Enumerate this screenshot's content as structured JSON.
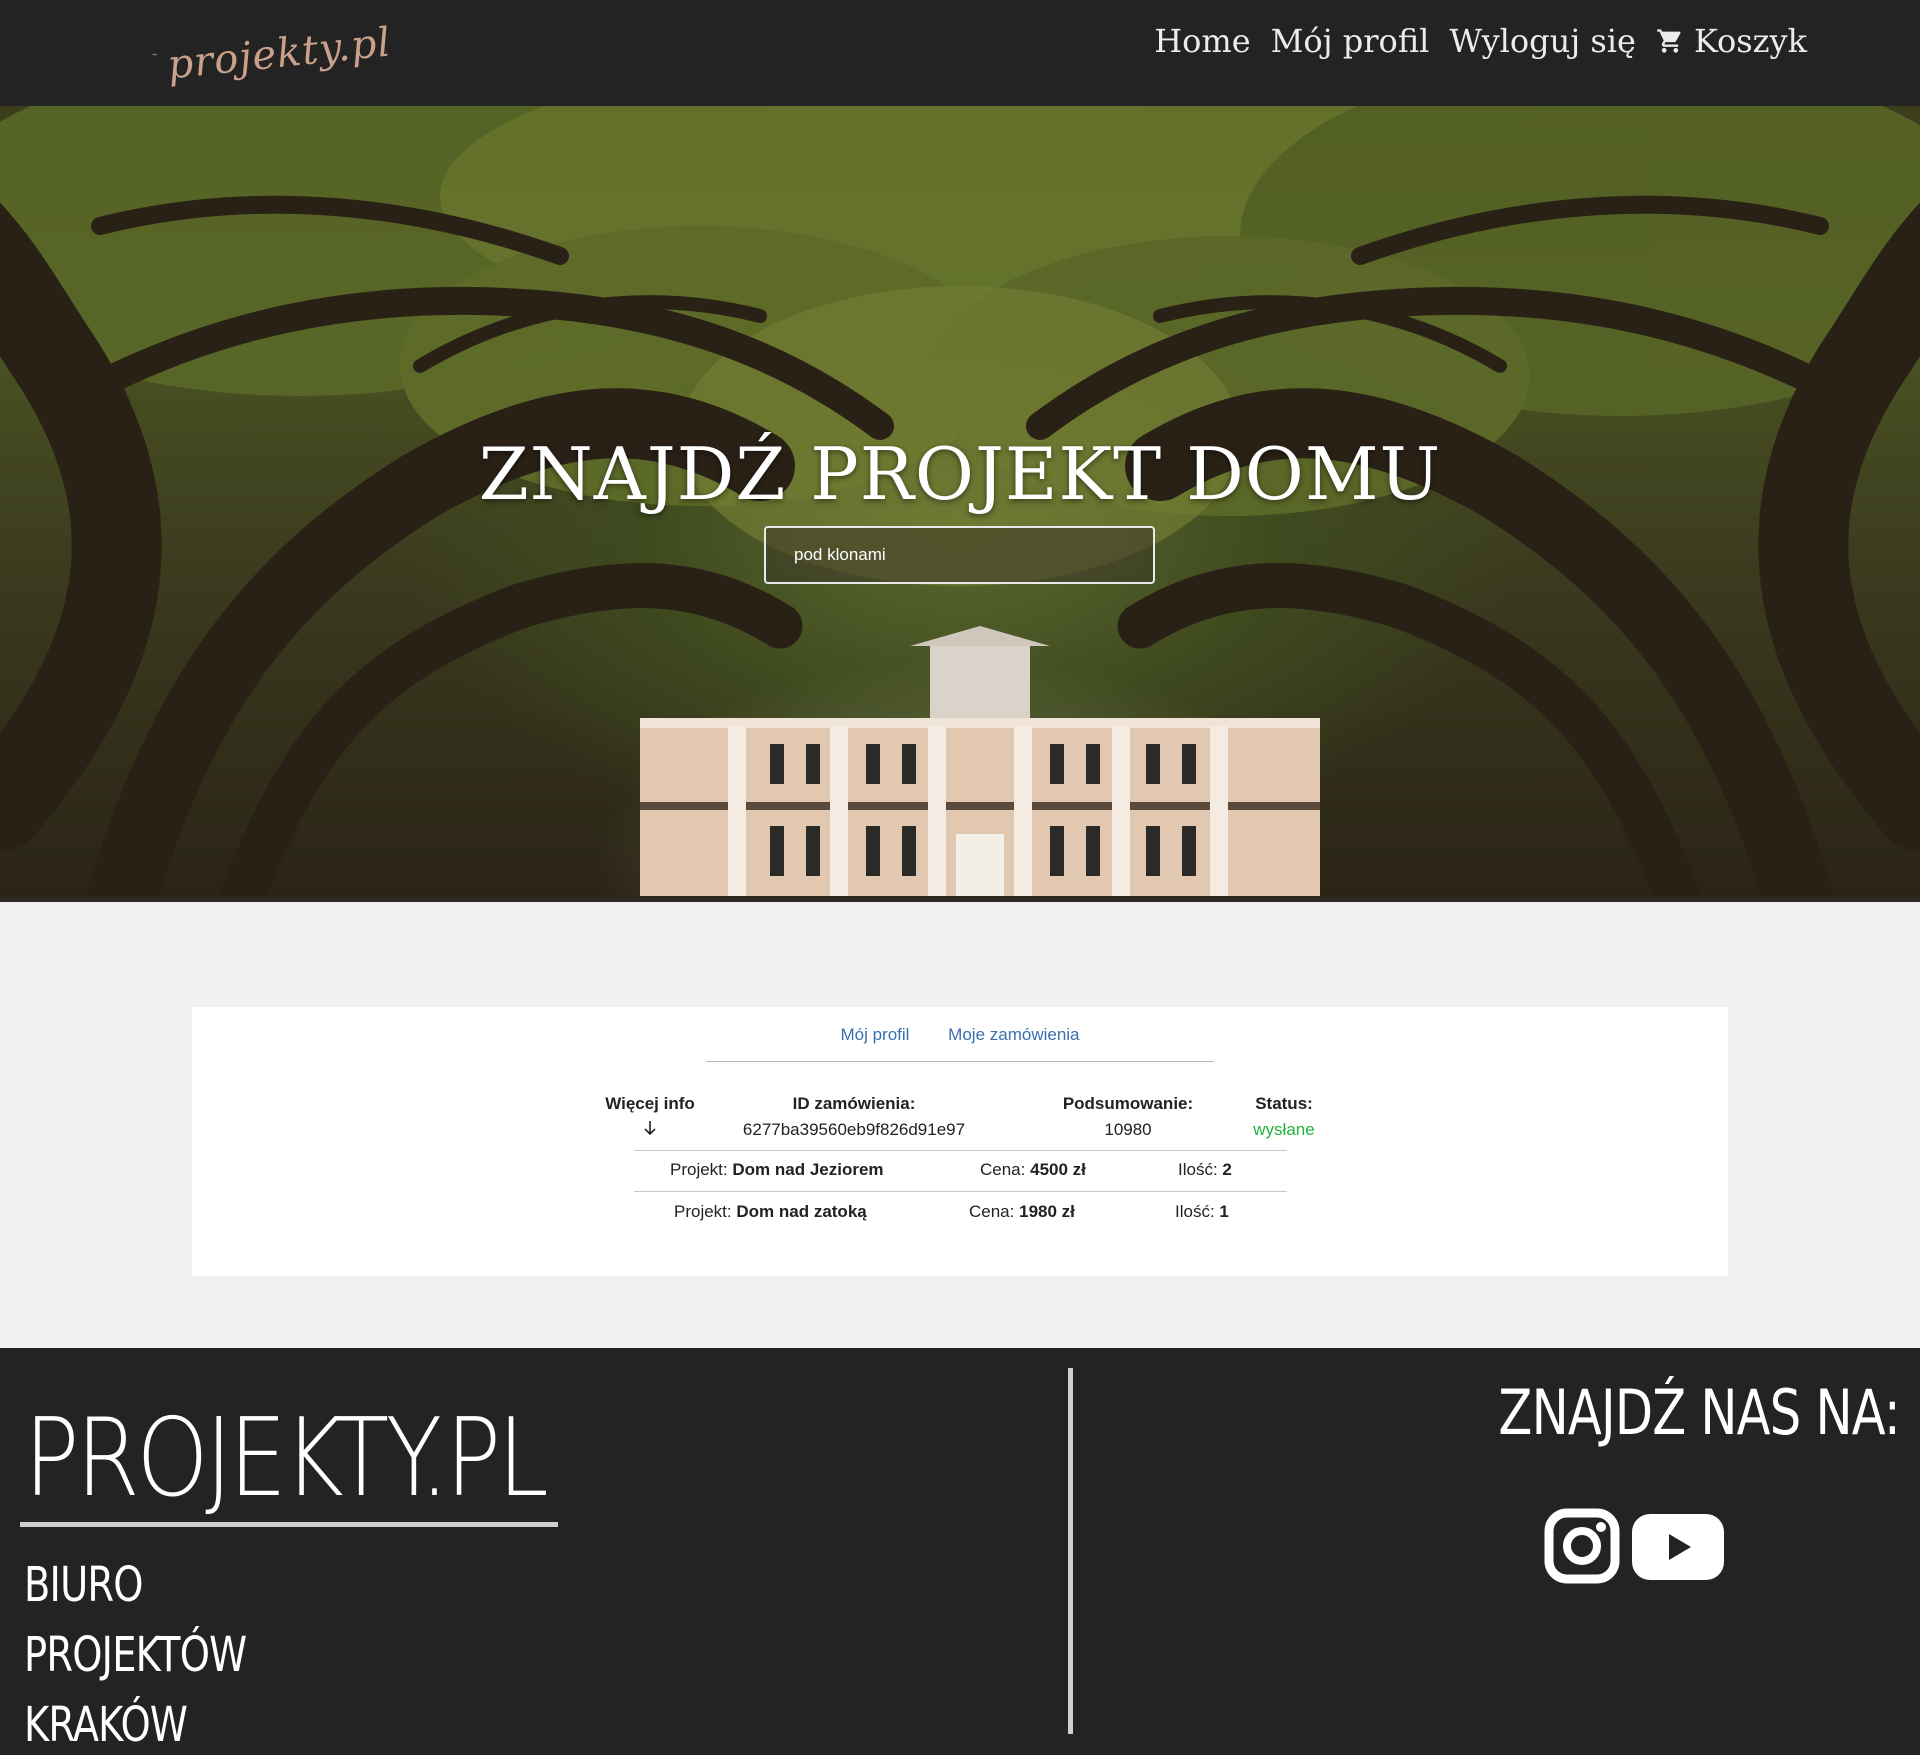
{
  "nav": {
    "logo_text": "projekty.pl",
    "links": [
      "Home",
      "Mój profil",
      "Wyloguj się",
      "Koszyk"
    ]
  },
  "hero": {
    "title": "ZNAJDŹ PROJEKT DOMU",
    "search_value": "pod klonami"
  },
  "profile": {
    "tabs": [
      "Mój profil",
      "Moje zamówienia"
    ],
    "order": {
      "more_info_label": "Więcej info",
      "id_label": "ID zamówienia:",
      "id_value": "6277ba39560eb9f826d91e97",
      "summary_label": "Podsumowanie:",
      "summary_value": "10980",
      "status_label": "Status:",
      "status_value": "wysłane",
      "status_color": "#23b23c",
      "items": [
        {
          "project_label": "Projekt:",
          "project": "Dom nad Jeziorem",
          "price_label": "Cena:",
          "price": "4500 zł",
          "qty_label": "Ilość:",
          "qty": "2"
        },
        {
          "project_label": "Projekt:",
          "project": "Dom nad zatoką",
          "price_label": "Cena:",
          "price": "1980 zł",
          "qty_label": "Ilość:",
          "qty": "1"
        }
      ]
    }
  },
  "footer": {
    "brand": "PROJEKTY.PL",
    "lines": [
      "BIURO",
      "PROJEKTÓW",
      "KRAKÓW"
    ],
    "find_us": "ZNAJDŹ NAS NA:",
    "social": [
      "instagram-icon",
      "youtube-icon"
    ]
  }
}
